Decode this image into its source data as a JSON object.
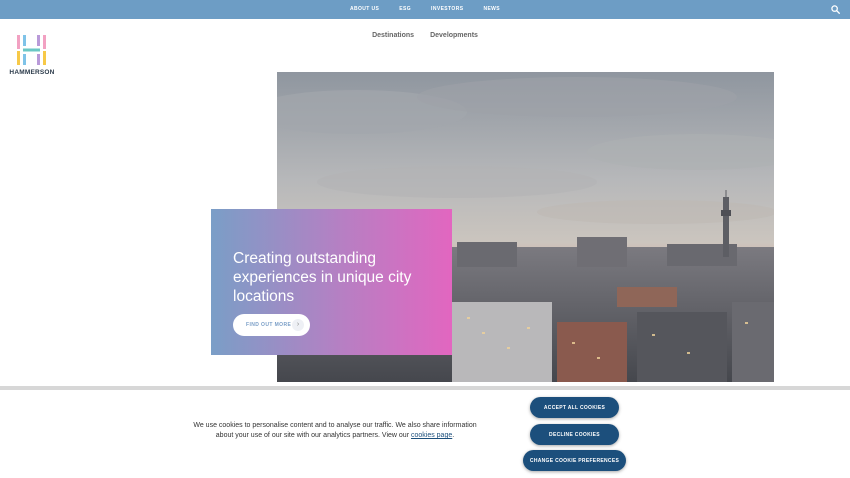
{
  "top_nav": [
    "ABOUT US",
    "ESG",
    "INVESTORS",
    "NEWS"
  ],
  "brand": {
    "name": "HAMMERSON"
  },
  "sub_nav": [
    "Destinations",
    "Developments"
  ],
  "hero": {
    "title": "Creating outstanding experiences in unique city locations",
    "cta_label": "FIND OUT MORE",
    "cta_icon": "chevron-right-icon"
  },
  "cookie_banner": {
    "text": "We use cookies to personalise content and to analyse our traffic. We also share information about your use of our site with our analytics partners. View our",
    "link_text": "cookies page",
    "trailing": ".",
    "accept_label": "ACCEPT ALL COOKIES",
    "decline_label": "DECLINE COOKIES",
    "preferences_label": "CHANGE COOKIE PREFERENCES"
  },
  "colors": {
    "top_bar": "#6d9dc5",
    "button": "#1c4f7c",
    "card_start": "#7a9ec7",
    "card_end": "#e266c0"
  }
}
